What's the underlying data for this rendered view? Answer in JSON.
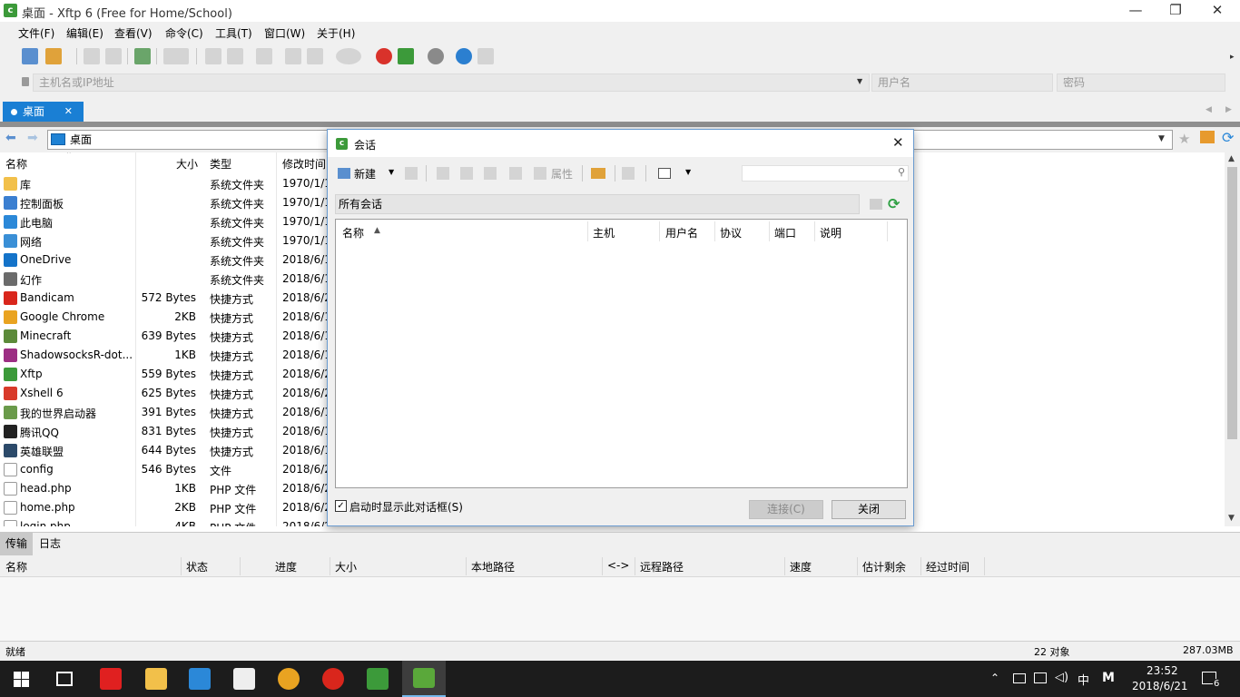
{
  "window": {
    "app_icon_letter": "c",
    "title": "桌面 - Xftp 6 (Free for Home/School)",
    "minimize": "—",
    "restore": "❐",
    "close": "✕"
  },
  "menubar": [
    "文件(F)",
    "编辑(E)",
    "查看(V)",
    "命令(C)",
    "工具(T)",
    "窗口(W)",
    "关于(H)"
  ],
  "addressbar": {
    "host_placeholder": "主机名或IP地址",
    "user_placeholder": "用户名",
    "password_placeholder": "密码"
  },
  "tab": {
    "label": "桌面",
    "close": "✕"
  },
  "path": {
    "value": "桌面"
  },
  "file_columns": [
    "名称",
    "大小",
    "类型",
    "修改时间"
  ],
  "files": [
    {
      "name": "库",
      "size": "",
      "type": "系统文件夹",
      "date": "1970/1/1",
      "color": "#f2c04a"
    },
    {
      "name": "控制面板",
      "size": "",
      "type": "系统文件夹",
      "date": "1970/1/1",
      "color": "#3b7fd1"
    },
    {
      "name": "此电脑",
      "size": "",
      "type": "系统文件夹",
      "date": "1970/1/1",
      "color": "#2b88d8"
    },
    {
      "name": "网络",
      "size": "",
      "type": "系统文件夹",
      "date": "1970/1/1",
      "color": "#3a8fd6"
    },
    {
      "name": "OneDrive",
      "size": "",
      "type": "系统文件夹",
      "date": "2018/6/1",
      "color": "#1473c9"
    },
    {
      "name": "幻作",
      "size": "",
      "type": "系统文件夹",
      "date": "2018/6/1",
      "color": "#6b6b6b"
    },
    {
      "name": "Bandicam",
      "size": "572 Bytes",
      "type": "快捷方式",
      "date": "2018/6/2",
      "color": "#d9261c"
    },
    {
      "name": "Google Chrome",
      "size": "2KB",
      "type": "快捷方式",
      "date": "2018/6/1",
      "color": "#e9a321"
    },
    {
      "name": "Minecraft",
      "size": "639 Bytes",
      "type": "快捷方式",
      "date": "2018/6/1",
      "color": "#5c8a3a"
    },
    {
      "name": "ShadowsocksR-dot...",
      "size": "1KB",
      "type": "快捷方式",
      "date": "2018/6/1",
      "color": "#9c2f83"
    },
    {
      "name": "Xftp",
      "size": "559 Bytes",
      "type": "快捷方式",
      "date": "2018/6/2",
      "color": "#3c9a3a"
    },
    {
      "name": "Xshell 6",
      "size": "625 Bytes",
      "type": "快捷方式",
      "date": "2018/6/2",
      "color": "#d83a2a"
    },
    {
      "name": "我的世界启动器",
      "size": "391 Bytes",
      "type": "快捷方式",
      "date": "2018/6/1",
      "color": "#6a9a4a"
    },
    {
      "name": "腾讯QQ",
      "size": "831 Bytes",
      "type": "快捷方式",
      "date": "2018/6/1",
      "color": "#222222"
    },
    {
      "name": "英雄联盟",
      "size": "644 Bytes",
      "type": "快捷方式",
      "date": "2018/6/1",
      "color": "#2c4a6a"
    },
    {
      "name": "config",
      "size": "546 Bytes",
      "type": "文件",
      "date": "2018/6/2",
      "color": "#ffffff"
    },
    {
      "name": "head.php",
      "size": "1KB",
      "type": "PHP 文件",
      "date": "2018/6/2",
      "color": "#ffffff"
    },
    {
      "name": "home.php",
      "size": "2KB",
      "type": "PHP 文件",
      "date": "2018/6/2",
      "color": "#ffffff"
    },
    {
      "name": "login.php",
      "size": "4KB",
      "type": "PHP 文件",
      "date": "2018/6/2",
      "color": "#ffffff"
    }
  ],
  "dialog": {
    "icon_letter": "c",
    "title": "会话",
    "close": "✕",
    "new_label": "新建",
    "properties_label": "属性",
    "folder": "所有会话",
    "columns": [
      "名称",
      "主机",
      "用户名",
      "协议",
      "端口",
      "说明"
    ],
    "startup_checkbox": "启动时显示此对话框(S)",
    "connect_button": "连接(C)",
    "close_button": "关闭"
  },
  "bottom_tabs": [
    "传输",
    "日志"
  ],
  "transfer_columns": [
    "名称",
    "状态",
    "进度",
    "大小",
    "本地路径",
    "<->",
    "远程路径",
    "速度",
    "估计剩余",
    "经过时间"
  ],
  "status": {
    "left": "就绪",
    "objects": "22 对象",
    "size": "287.03MB"
  },
  "taskbar": {
    "ime": "中",
    "ime_mode": "M",
    "time": "23:52",
    "date": "2018/6/21",
    "notifications": "6"
  }
}
